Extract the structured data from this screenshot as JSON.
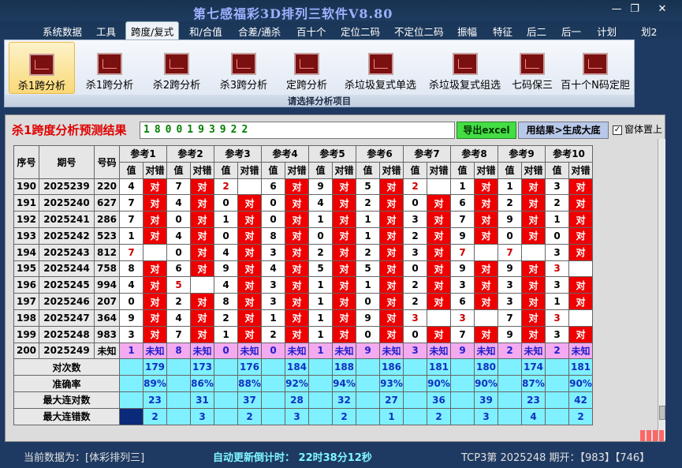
{
  "window": {
    "title": "第七感福彩3D排列三软件V8.80",
    "minimize": "—",
    "maximize": "❐",
    "close": "✕"
  },
  "menu": [
    "系统数据",
    "工具",
    "跨度/复式",
    "和/合值",
    "合差/通杀",
    "百十个",
    "定位二码",
    "不定位二码",
    "振幅",
    "特征",
    "后二",
    "后一",
    "计划",
    "划2"
  ],
  "menu_active": 2,
  "ribbon": {
    "buttons": [
      "杀1跨分析",
      "杀1跨分析",
      "杀2跨分析",
      "杀3跨分析",
      "定跨分析",
      "杀垃圾复式单选",
      "杀垃圾复式组选",
      "七码保三",
      "百十个N码定胆"
    ],
    "selected": 0,
    "caption": "请选择分析项目"
  },
  "panel": {
    "title": "杀1跨度分析预测结果",
    "prediction": "1800193922",
    "export_button": "导出excel",
    "generate_button": "用结果>生成大底",
    "checkbox_label": "窗体置上",
    "checkbox_checked": true
  },
  "table": {
    "headers": {
      "seq": "序号",
      "period": "期号",
      "number": "号码",
      "value": "值",
      "result": "对错"
    },
    "groups": [
      "参考1",
      "参考2",
      "参考3",
      "参考4",
      "参考5",
      "参考6",
      "参考7",
      "参考8",
      "参考9",
      "参考10"
    ],
    "rows": [
      {
        "seq": "190",
        "period": "2025239",
        "num": "220",
        "cells": [
          [
            "4",
            "对"
          ],
          [
            "7",
            "对"
          ],
          [
            "2",
            ""
          ],
          [
            "6",
            "对"
          ],
          [
            "9",
            "对"
          ],
          [
            "5",
            "对"
          ],
          [
            "2",
            ""
          ],
          [
            "1",
            "对"
          ],
          [
            "1",
            "对"
          ],
          [
            "3",
            "对"
          ]
        ]
      },
      {
        "seq": "191",
        "period": "2025240",
        "num": "627",
        "cells": [
          [
            "7",
            "对"
          ],
          [
            "4",
            "对"
          ],
          [
            "0",
            "对"
          ],
          [
            "0",
            "对"
          ],
          [
            "4",
            "对"
          ],
          [
            "2",
            "对"
          ],
          [
            "0",
            "对"
          ],
          [
            "6",
            "对"
          ],
          [
            "2",
            "对"
          ],
          [
            "2",
            "对"
          ]
        ]
      },
      {
        "seq": "192",
        "period": "2025241",
        "num": "286",
        "cells": [
          [
            "7",
            "对"
          ],
          [
            "0",
            "对"
          ],
          [
            "1",
            "对"
          ],
          [
            "0",
            "对"
          ],
          [
            "1",
            "对"
          ],
          [
            "1",
            "对"
          ],
          [
            "3",
            "对"
          ],
          [
            "7",
            "对"
          ],
          [
            "9",
            "对"
          ],
          [
            "1",
            "对"
          ]
        ]
      },
      {
        "seq": "193",
        "period": "2025242",
        "num": "523",
        "cells": [
          [
            "1",
            "对"
          ],
          [
            "4",
            "对"
          ],
          [
            "0",
            "对"
          ],
          [
            "8",
            "对"
          ],
          [
            "0",
            "对"
          ],
          [
            "1",
            "对"
          ],
          [
            "2",
            "对"
          ],
          [
            "9",
            "对"
          ],
          [
            "0",
            "对"
          ],
          [
            "0",
            "对"
          ]
        ]
      },
      {
        "seq": "194",
        "period": "2025243",
        "num": "812",
        "cells": [
          [
            "7",
            ""
          ],
          [
            "0",
            "对"
          ],
          [
            "4",
            "对"
          ],
          [
            "3",
            "对"
          ],
          [
            "2",
            "对"
          ],
          [
            "2",
            "对"
          ],
          [
            "3",
            "对"
          ],
          [
            "7",
            ""
          ],
          [
            "7",
            ""
          ],
          [
            "3",
            "对"
          ]
        ]
      },
      {
        "seq": "195",
        "period": "2025244",
        "num": "758",
        "cells": [
          [
            "8",
            "对"
          ],
          [
            "6",
            "对"
          ],
          [
            "9",
            "对"
          ],
          [
            "4",
            "对"
          ],
          [
            "5",
            "对"
          ],
          [
            "5",
            "对"
          ],
          [
            "0",
            "对"
          ],
          [
            "9",
            "对"
          ],
          [
            "9",
            "对"
          ],
          [
            "3",
            ""
          ]
        ]
      },
      {
        "seq": "196",
        "period": "2025245",
        "num": "994",
        "cells": [
          [
            "4",
            "对"
          ],
          [
            "5",
            ""
          ],
          [
            "4",
            "对"
          ],
          [
            "3",
            "对"
          ],
          [
            "1",
            "对"
          ],
          [
            "1",
            "对"
          ],
          [
            "2",
            "对"
          ],
          [
            "3",
            "对"
          ],
          [
            "3",
            "对"
          ],
          [
            "3",
            "对"
          ]
        ]
      },
      {
        "seq": "197",
        "period": "2025246",
        "num": "207",
        "cells": [
          [
            "0",
            "对"
          ],
          [
            "2",
            "对"
          ],
          [
            "8",
            "对"
          ],
          [
            "3",
            "对"
          ],
          [
            "1",
            "对"
          ],
          [
            "0",
            "对"
          ],
          [
            "2",
            "对"
          ],
          [
            "6",
            "对"
          ],
          [
            "3",
            "对"
          ],
          [
            "1",
            "对"
          ]
        ]
      },
      {
        "seq": "198",
        "period": "2025247",
        "num": "364",
        "cells": [
          [
            "9",
            "对"
          ],
          [
            "4",
            "对"
          ],
          [
            "2",
            "对"
          ],
          [
            "1",
            "对"
          ],
          [
            "1",
            "对"
          ],
          [
            "9",
            "对"
          ],
          [
            "3",
            ""
          ],
          [
            "3",
            ""
          ],
          [
            "7",
            "对"
          ],
          [
            "3",
            ""
          ]
        ]
      },
      {
        "seq": "199",
        "period": "2025248",
        "num": "983",
        "cells": [
          [
            "3",
            "对"
          ],
          [
            "7",
            "对"
          ],
          [
            "1",
            "对"
          ],
          [
            "2",
            "对"
          ],
          [
            "1",
            "对"
          ],
          [
            "0",
            "对"
          ],
          [
            "0",
            "对"
          ],
          [
            "7",
            "对"
          ],
          [
            "9",
            "对"
          ],
          [
            "3",
            "对"
          ]
        ]
      }
    ],
    "current": {
      "seq": "200",
      "period": "2025249",
      "num": "未知",
      "cells": [
        [
          "1",
          "未知"
        ],
        [
          "8",
          "未知"
        ],
        [
          "0",
          "未知"
        ],
        [
          "0",
          "未知"
        ],
        [
          "1",
          "未知"
        ],
        [
          "9",
          "未知"
        ],
        [
          "3",
          "未知"
        ],
        [
          "9",
          "未知"
        ],
        [
          "2",
          "未知"
        ],
        [
          "2",
          "未知"
        ]
      ]
    },
    "stats": [
      {
        "label": "对次数",
        "values": [
          "179",
          "173",
          "176",
          "184",
          "188",
          "186",
          "181",
          "180",
          "174",
          "181"
        ]
      },
      {
        "label": "准确率",
        "values": [
          "89%",
          "86%",
          "88%",
          "92%",
          "94%",
          "93%",
          "90%",
          "90%",
          "87%",
          "90%"
        ]
      },
      {
        "label": "最大连对数",
        "values": [
          "23",
          "31",
          "37",
          "28",
          "32",
          "27",
          "36",
          "39",
          "23",
          "42"
        ]
      },
      {
        "label": "最大连错数",
        "values": [
          "2",
          "3",
          "2",
          "3",
          "2",
          "1",
          "2",
          "3",
          "4",
          "2"
        ]
      }
    ]
  },
  "status": {
    "current_data": "当前数据为：[体彩排列三]",
    "countdown": "自动更新倒计时：  22时38分12秒",
    "tcp": "TCP3第 2025248 期开：【983】【746】"
  },
  "colors": {
    "hit_cell": "#ee0000",
    "stat_cell": "#7ff0ff",
    "current_row": "#f4aaf0",
    "title_red": "#e00000"
  }
}
